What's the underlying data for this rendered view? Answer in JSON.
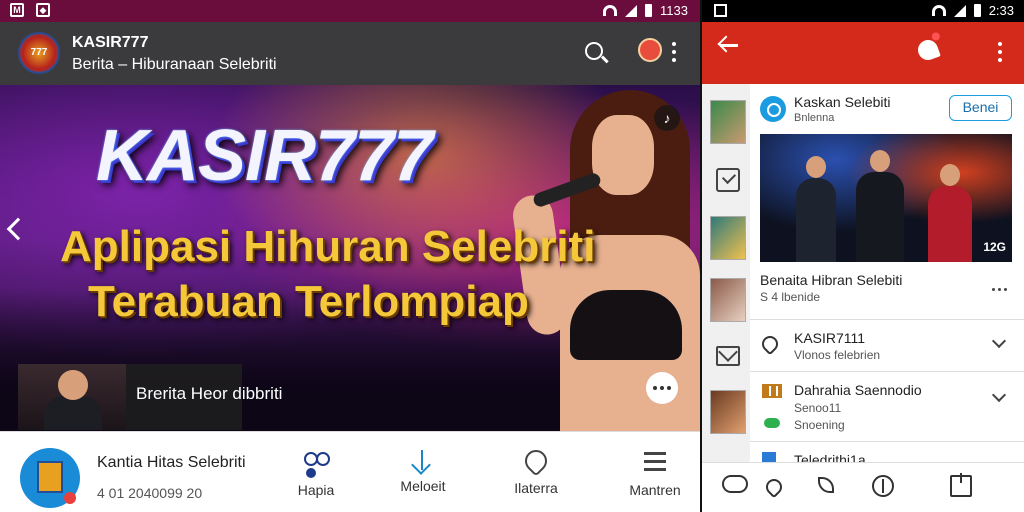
{
  "left": {
    "statusbar": {
      "time": "1133",
      "icons": [
        "gmail-icon",
        "photo-icon"
      ]
    },
    "appbar": {
      "title": "KASIR777",
      "subtitle": "Berita – Hiburanaan Selebriti"
    },
    "hero": {
      "brand": "KASIR777",
      "line1": "Aplipasi Hihuran Selebriti",
      "line2": "Terabuan Terlompiap",
      "caption": "Brerita Heor dibbriti"
    },
    "bottom": {
      "name": "Kantia Hitas Selebriti",
      "date": "4 01 2040099 20",
      "tabs": [
        {
          "label": "Hapia",
          "icon": "people-icon"
        },
        {
          "label": "Meloeit",
          "icon": "download-icon"
        },
        {
          "label": "Ilaterra",
          "icon": "heart-icon"
        },
        {
          "label": "Mantren",
          "icon": "menu-icon"
        }
      ]
    }
  },
  "right": {
    "statusbar": {
      "time": "2:33"
    },
    "card": {
      "title": "Kaskan Selebiti",
      "subtitle": "Bnlenna",
      "follow_label": "Benei",
      "photo_badge": "12G",
      "post_title": "Benaita Hibran Selebiti",
      "post_meta": "S 4 lbenide"
    },
    "rows": [
      {
        "line1": "KASIR7111",
        "line2": "Vlonos felebrien"
      },
      {
        "line1": "Dahrahia Saennodio",
        "line2": "Senoo11",
        "line3": "Snoening"
      },
      {
        "line1": "Teledrithi1a",
        "line2": ""
      }
    ]
  },
  "colors": {
    "left_statusbar": "#6a0d3c",
    "left_appbar": "#3b3b3e",
    "right_appbar": "#d32a1c",
    "accent_blue": "#1b9be0"
  }
}
